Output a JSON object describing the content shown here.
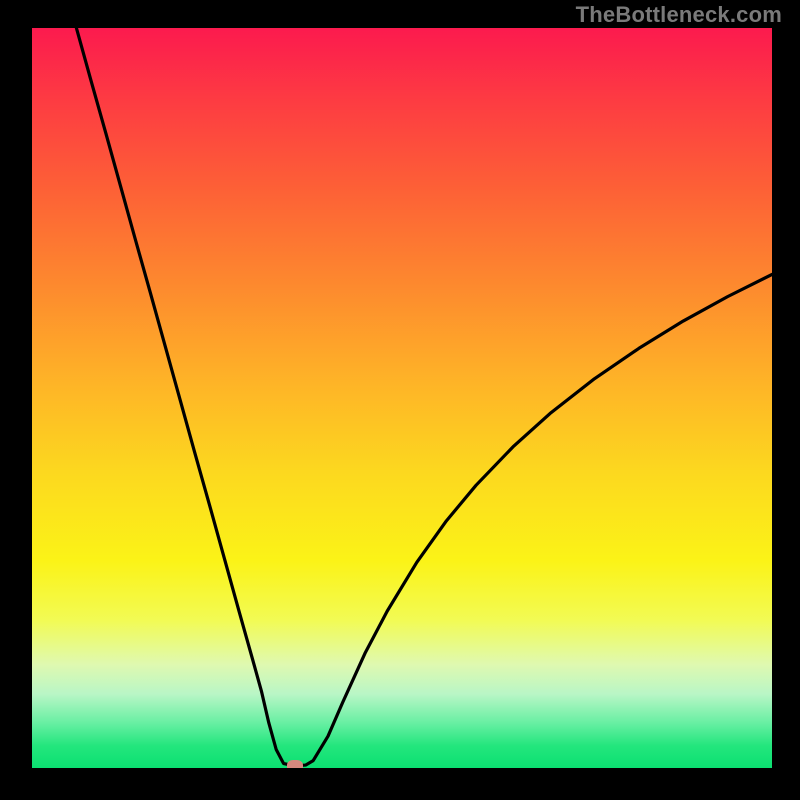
{
  "watermark": "TheBottleneck.com",
  "chart_data": {
    "type": "line",
    "title": "",
    "xlabel": "",
    "ylabel": "",
    "xlim": [
      0,
      100
    ],
    "ylim": [
      0,
      100
    ],
    "gradient_stops": [
      {
        "pos": 0,
        "color": "#fc1a4e"
      },
      {
        "pos": 10,
        "color": "#fd3c42"
      },
      {
        "pos": 22,
        "color": "#fd6136"
      },
      {
        "pos": 35,
        "color": "#fd8a2e"
      },
      {
        "pos": 48,
        "color": "#feb427"
      },
      {
        "pos": 60,
        "color": "#fcd81f"
      },
      {
        "pos": 72,
        "color": "#fbf317"
      },
      {
        "pos": 80,
        "color": "#f2fb54"
      },
      {
        "pos": 86,
        "color": "#dff9b0"
      },
      {
        "pos": 90,
        "color": "#b9f6c6"
      },
      {
        "pos": 94,
        "color": "#66efa2"
      },
      {
        "pos": 97,
        "color": "#23e67d"
      },
      {
        "pos": 100,
        "color": "#0be071"
      }
    ],
    "series": [
      {
        "name": "bottleneck-curve",
        "x": [
          6,
          8,
          10,
          12,
          14,
          16,
          18,
          20,
          22,
          24,
          26,
          28,
          30,
          31,
          32,
          33,
          34,
          35.5,
          37,
          38,
          40,
          42,
          45,
          48,
          52,
          56,
          60,
          65,
          70,
          76,
          82,
          88,
          94,
          100
        ],
        "y": [
          100,
          92.8,
          85.7,
          78.5,
          71.3,
          64.2,
          57.0,
          49.8,
          42.6,
          35.5,
          28.3,
          21.1,
          14.0,
          10.4,
          6.1,
          2.5,
          0.6,
          0.3,
          0.4,
          1.0,
          4.3,
          8.9,
          15.5,
          21.2,
          27.8,
          33.4,
          38.2,
          43.4,
          47.9,
          52.6,
          56.7,
          60.4,
          63.7,
          66.7
        ]
      }
    ],
    "marker": {
      "x": 35.5,
      "y": 0.3,
      "color": "#d6887e"
    },
    "plot_background": "gradient",
    "frame_color": "#000000"
  }
}
